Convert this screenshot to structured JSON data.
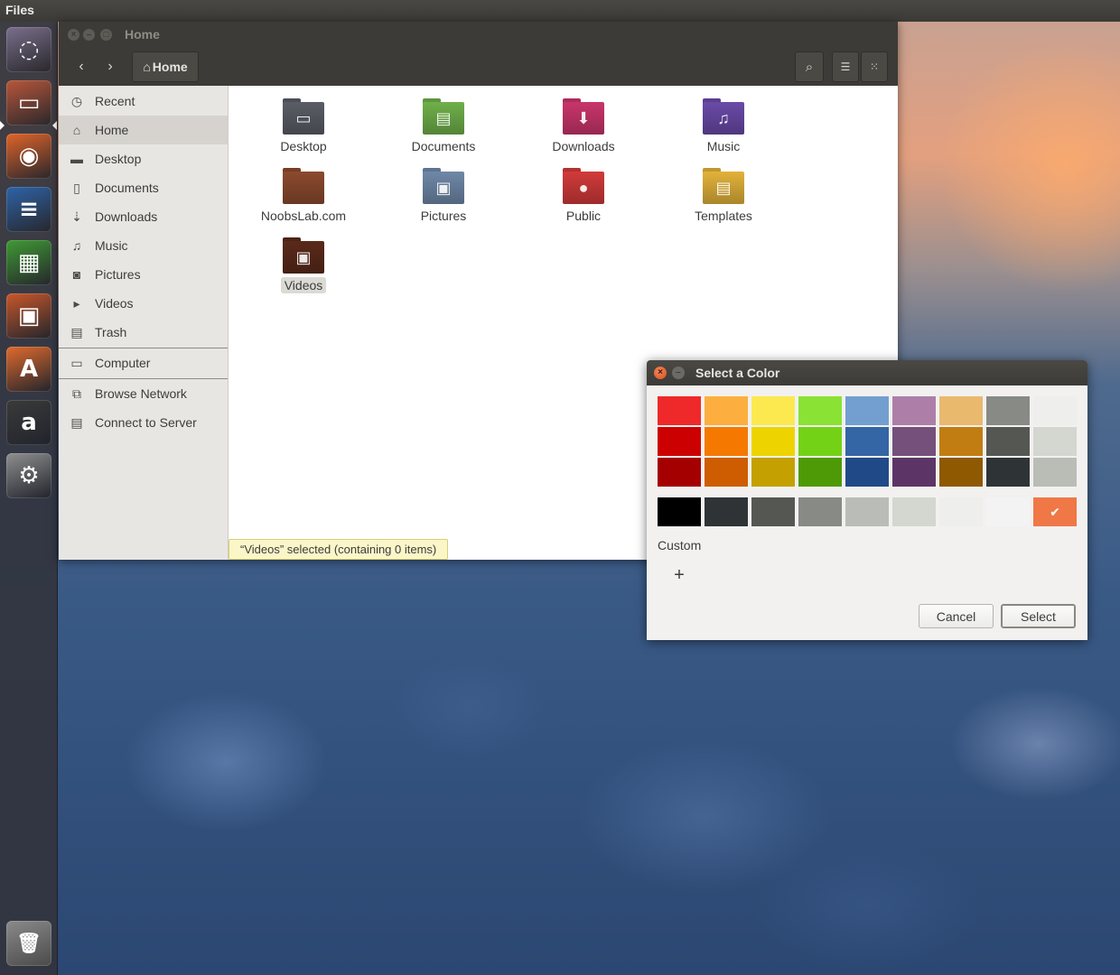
{
  "top_panel": {
    "app_name": "Files"
  },
  "launcher": {
    "items": [
      {
        "name": "ubuntu-dash",
        "glyph": "◌",
        "color": "#7a6f8c"
      },
      {
        "name": "files",
        "glyph": "▭",
        "color": "#b8563a"
      },
      {
        "name": "firefox",
        "glyph": "◉",
        "color": "#e1642a"
      },
      {
        "name": "libreoffice-writer",
        "glyph": "≡",
        "color": "#2d63a8"
      },
      {
        "name": "libreoffice-calc",
        "glyph": "▦",
        "color": "#3f9a34"
      },
      {
        "name": "libreoffice-impress",
        "glyph": "▣",
        "color": "#c8572a"
      },
      {
        "name": "software-center",
        "glyph": "A",
        "color": "#e06a2c"
      },
      {
        "name": "amazon",
        "glyph": "a",
        "color": "#3a3a3a"
      },
      {
        "name": "system-settings",
        "glyph": "⚙",
        "color": "#8f8f8f"
      }
    ],
    "trash": {
      "name": "trash",
      "glyph": "🗑",
      "color": "#777777"
    }
  },
  "files_window": {
    "title": "Home",
    "location": "Home",
    "sidebar": [
      {
        "icon": "clock-icon",
        "glyph": "◷",
        "label": "Recent"
      },
      {
        "icon": "home-icon",
        "glyph": "⌂",
        "label": "Home"
      },
      {
        "icon": "folder-icon",
        "glyph": "▬",
        "label": "Desktop"
      },
      {
        "icon": "document-icon",
        "glyph": "▯",
        "label": "Documents"
      },
      {
        "icon": "download-icon",
        "glyph": "⇣",
        "label": "Downloads"
      },
      {
        "icon": "music-icon",
        "glyph": "♫",
        "label": "Music"
      },
      {
        "icon": "camera-icon",
        "glyph": "◙",
        "label": "Pictures"
      },
      {
        "icon": "video-icon",
        "glyph": "▸",
        "label": "Videos"
      },
      {
        "icon": "trash-icon",
        "glyph": "▤",
        "label": "Trash"
      },
      {
        "icon": "computer-icon",
        "glyph": "▭",
        "label": "Computer"
      },
      {
        "icon": "network-icon",
        "glyph": "⧉",
        "label": "Browse Network"
      },
      {
        "icon": "server-icon",
        "glyph": "▤",
        "label": "Connect to Server"
      }
    ],
    "folders": [
      {
        "label": "Desktop",
        "color": "#5b5d66",
        "glyph": "▭"
      },
      {
        "label": "Documents",
        "color": "#6fb04a",
        "glyph": "▤"
      },
      {
        "label": "Downloads",
        "color": "#c9356b",
        "glyph": "⬇"
      },
      {
        "label": "Music",
        "color": "#6a4aa8",
        "glyph": "♫"
      },
      {
        "label": "NoobsLab.com",
        "color": "#8b4a2e",
        "glyph": ""
      },
      {
        "label": "Pictures",
        "color": "#6f88a8",
        "glyph": "▣"
      },
      {
        "label": "Public",
        "color": "#d23a3a",
        "glyph": "●"
      },
      {
        "label": "Templates",
        "color": "#e2b23a",
        "glyph": "▤"
      },
      {
        "label": "Videos",
        "color": "#5a2a1a",
        "glyph": "▣"
      }
    ],
    "status": "“Videos” selected  (containing 0 items)"
  },
  "color_dialog": {
    "title": "Select a Color",
    "palette": [
      [
        "#ef2929",
        "#fcaf3e",
        "#fce94f",
        "#8ae234",
        "#729fcf",
        "#ad7fa8",
        "#e9b96e",
        "#888a85",
        "#eeeeec"
      ],
      [
        "#cc0000",
        "#f57900",
        "#edd400",
        "#73d216",
        "#3465a4",
        "#75507b",
        "#c17d11",
        "#555753",
        "#d3d7cf"
      ],
      [
        "#a40000",
        "#ce5c00",
        "#c4a000",
        "#4e9a06",
        "#204a87",
        "#5c3566",
        "#8f5902",
        "#2e3436",
        "#babdb6"
      ]
    ],
    "grays": [
      "#000000",
      "#2e3436",
      "#555753",
      "#888a85",
      "#babdb6",
      "#d3d7cf",
      "#eeeeec",
      "#f3f3f3",
      "#f07746"
    ],
    "selected_color": "#f07746",
    "custom_label": "Custom",
    "add_custom": "+",
    "cancel_label": "Cancel",
    "select_label": "Select"
  }
}
